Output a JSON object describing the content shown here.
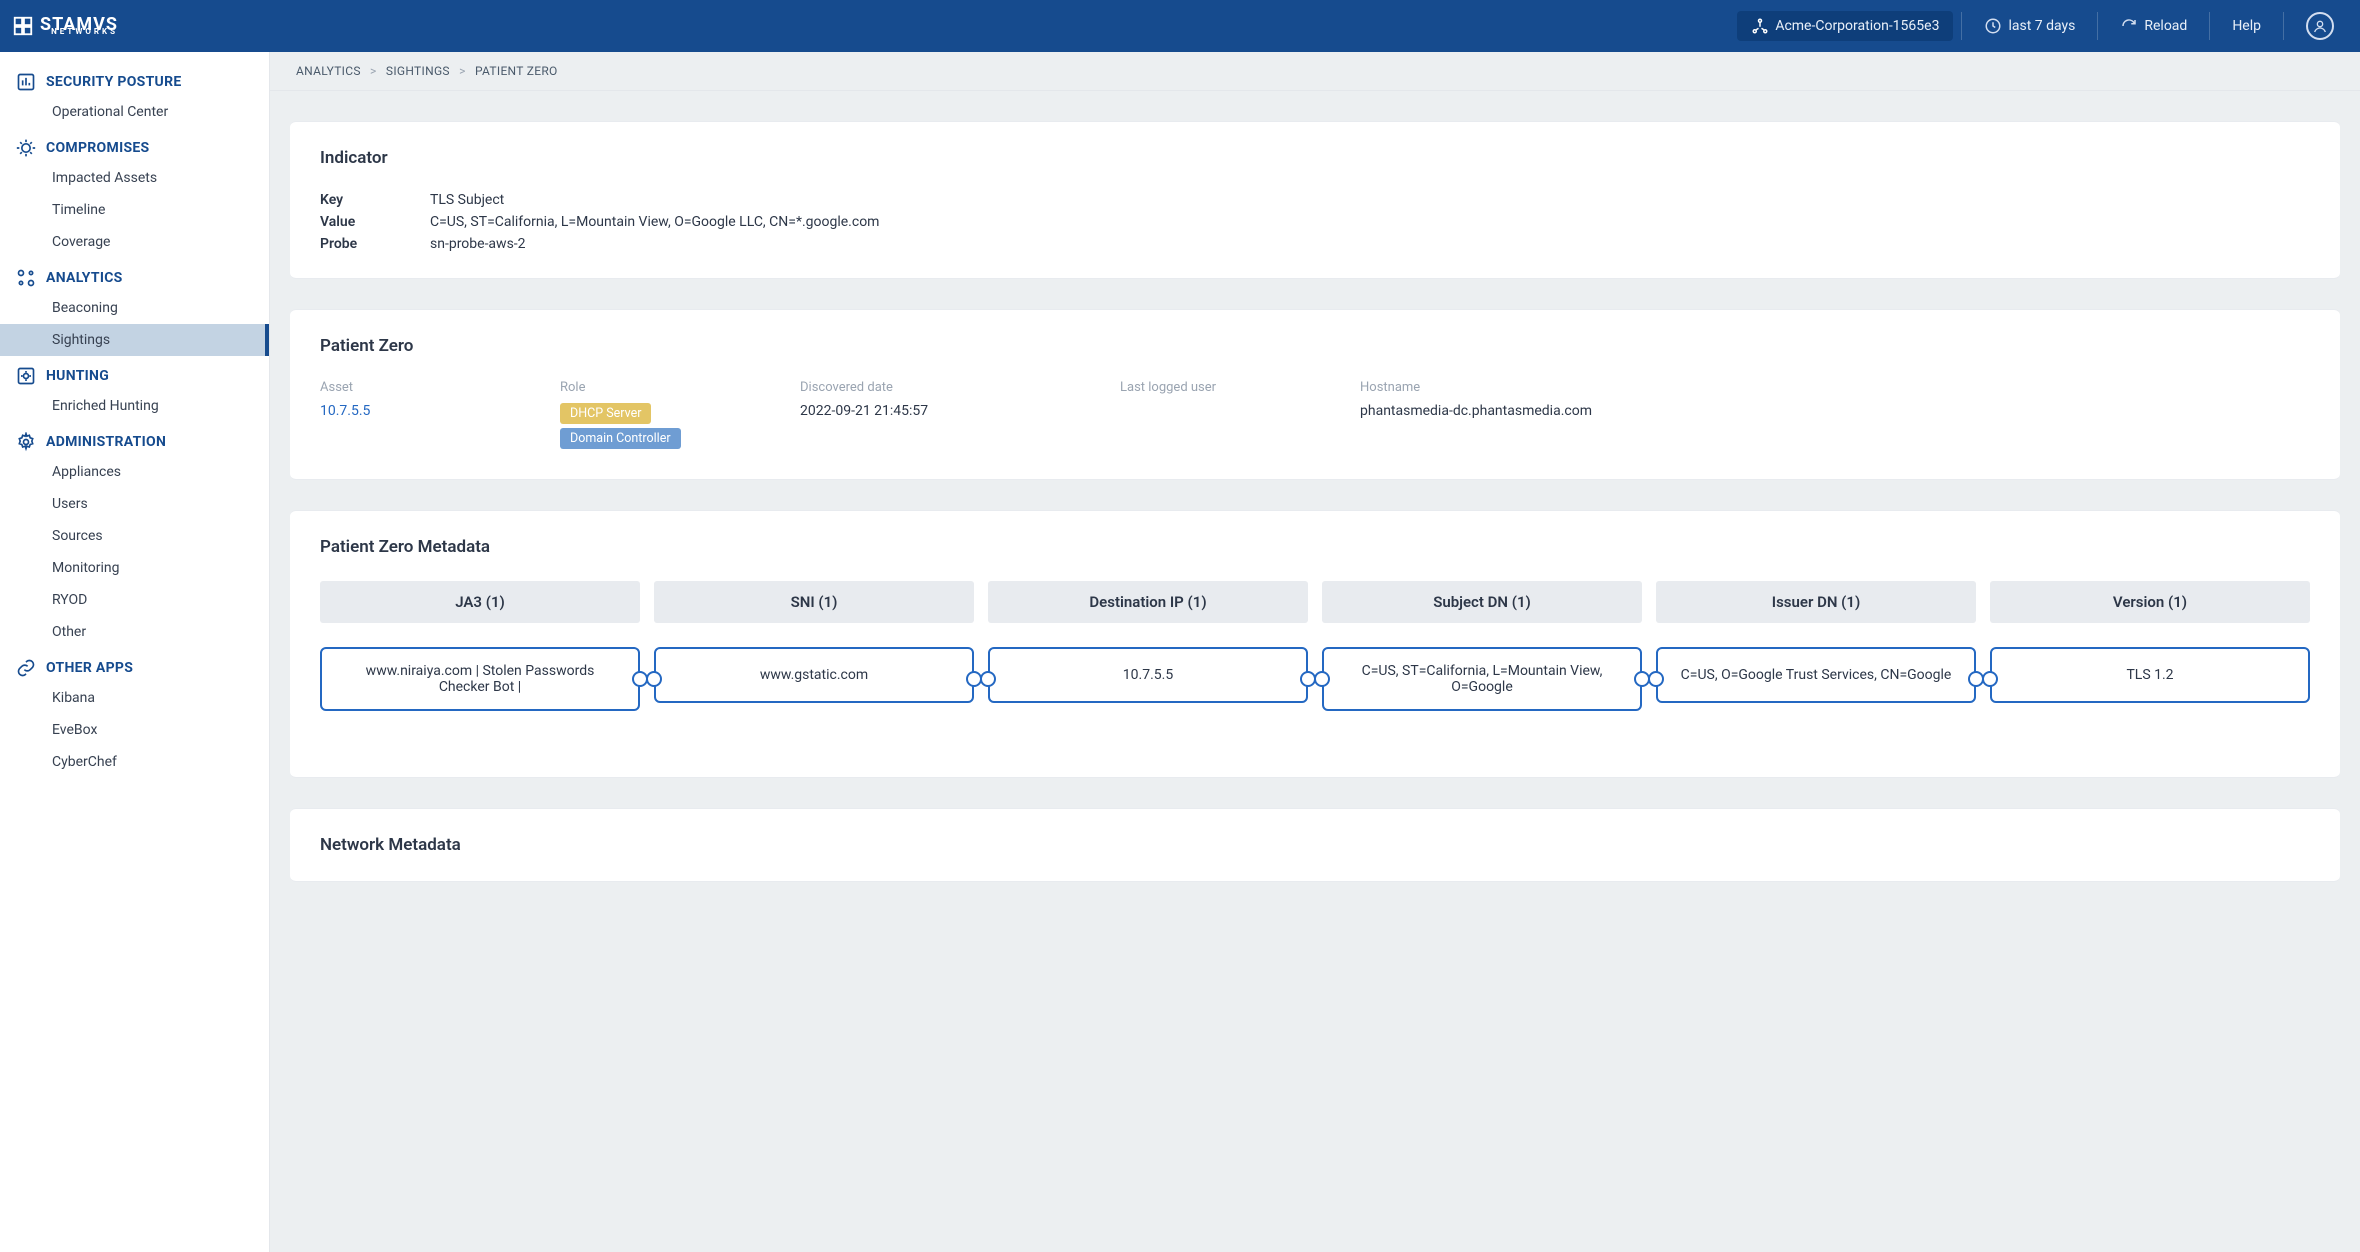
{
  "header": {
    "brand_main": "STAMVS",
    "brand_sub": "NETWORKS",
    "org": "Acme-Corporation-1565e3",
    "timerange": "last 7 days",
    "reload": "Reload",
    "help": "Help"
  },
  "breadcrumb": {
    "a": "ANALYTICS",
    "b": "SIGHTINGS",
    "c": "PATIENT ZERO"
  },
  "sidebar": {
    "security_posture": "SECURITY POSTURE",
    "operational_center": "Operational Center",
    "compromises": "COMPROMISES",
    "impacted_assets": "Impacted Assets",
    "timeline": "Timeline",
    "coverage": "Coverage",
    "analytics": "ANALYTICS",
    "beaconing": "Beaconing",
    "sightings": "Sightings",
    "hunting": "HUNTING",
    "enriched_hunting": "Enriched Hunting",
    "administration": "ADMINISTRATION",
    "appliances": "Appliances",
    "users": "Users",
    "sources": "Sources",
    "monitoring": "Monitoring",
    "ryod": "RYOD",
    "other": "Other",
    "other_apps": "OTHER APPS",
    "kibana": "Kibana",
    "evebox": "EveBox",
    "cyberchef": "CyberChef"
  },
  "indicator": {
    "title": "Indicator",
    "keys": {
      "key": "Key",
      "value": "Value",
      "probe": "Probe"
    },
    "vals": {
      "key": "TLS Subject",
      "value": "C=US, ST=California, L=Mountain View, O=Google LLC, CN=*.google.com",
      "probe": "sn-probe-aws-2"
    }
  },
  "patient_zero": {
    "title": "Patient Zero",
    "asset_label": "Asset",
    "asset_value": "10.7.5.5",
    "role_label": "Role",
    "role_badge1": "DHCP Server",
    "role_badge2": "Domain Controller",
    "discovered_label": "Discovered date",
    "discovered_value": "2022-09-21 21:45:57",
    "last_user_label": "Last logged user",
    "last_user_value": "",
    "hostname_label": "Hostname",
    "hostname_value": "phantasmedia-dc.phantasmedia.com"
  },
  "metadata": {
    "title": "Patient Zero Metadata",
    "headers": {
      "ja3": "JA3 (1)",
      "sni": "SNI (1)",
      "dest": "Destination IP (1)",
      "subj": "Subject DN (1)",
      "issuer": "Issuer DN (1)",
      "version": "Version (1)"
    },
    "cells": {
      "ja3": "www.niraiya.com | Stolen Passwords Checker Bot |",
      "sni": "www.gstatic.com",
      "dest": "10.7.5.5",
      "subj": "C=US, ST=California, L=Mountain View, O=Google",
      "issuer": "C=US, O=Google Trust Services, CN=Google",
      "version": "TLS 1.2"
    }
  },
  "network_metadata": {
    "title": "Network Metadata"
  }
}
